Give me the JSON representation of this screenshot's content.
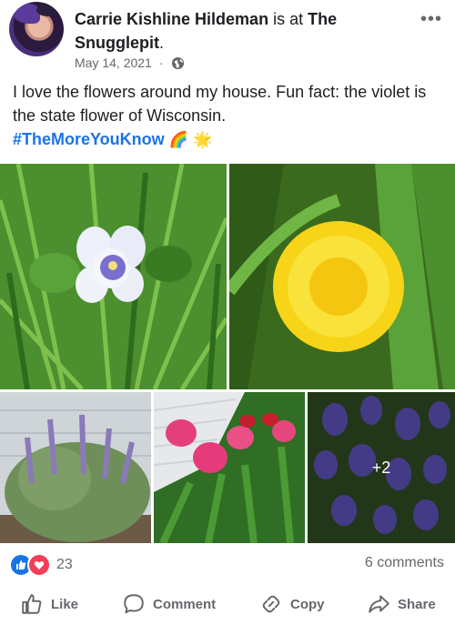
{
  "post": {
    "author_name": "Carrie Kishline Hildeman",
    "is_at": " is at ",
    "place": "The Snugglepit",
    "place_suffix": ".",
    "date": "May 14, 2021",
    "dot": "·",
    "text": "I love the flowers around my house. Fun fact: the violet is the state flower of Wisconsin.",
    "hashtag": "#TheMoreYouKnow",
    "emojis": "🌈 🌟",
    "more_count": "+2"
  },
  "stats": {
    "reaction_count": "23",
    "comments": "6 comments"
  },
  "actions": {
    "like": "Like",
    "comment": "Comment",
    "copy": "Copy",
    "share": "Share"
  },
  "colors": {
    "link": "#1b74e4",
    "like": "#1b74e4",
    "love": "#f33e58",
    "muted": "#65676b"
  }
}
